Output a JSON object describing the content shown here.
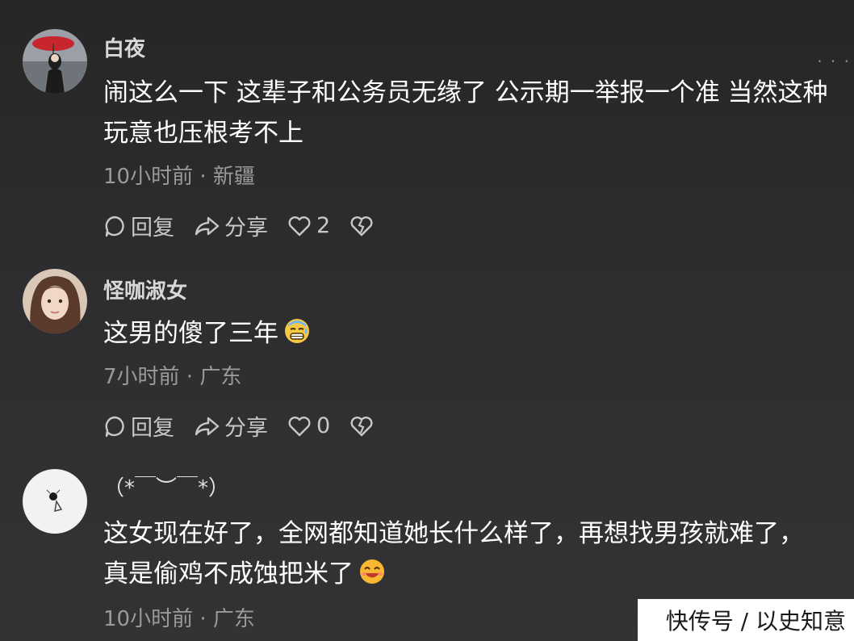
{
  "comments": [
    {
      "username": "白夜",
      "text": "闹这么一下 这辈子和公务员无缘了 公示期一举报一个准 当然这种玩意也压根考不上",
      "meta": "10小时前 · 新疆",
      "reply_label": "回复",
      "share_label": "分享",
      "like_count": "2",
      "avatar": "avatar-red-umbrella"
    },
    {
      "username": "怪咖淑女",
      "text": "这男的傻了三年",
      "emoji": "anxious-sweat-emoji",
      "meta": "7小时前 · 广东",
      "reply_label": "回复",
      "share_label": "分享",
      "like_count": "0",
      "avatar": "avatar-woman-portrait"
    },
    {
      "username": "（*￣︶￣*）",
      "text": "这女现在好了，全网都知道她长什么样了，再想找男孩就难了，真是偷鸡不成蚀把米了",
      "emoji": "grinning-blush-emoji",
      "meta": "10小时前 · 广东",
      "avatar": "avatar-white-sketch"
    }
  ],
  "more_icon": "more-dots-icon",
  "watermark": "快传号 / 以史知意",
  "colors": {
    "background": "#2b2b2d",
    "text": "#ffffff",
    "meta": "#9a9a9a",
    "action": "#c8c8c8"
  }
}
